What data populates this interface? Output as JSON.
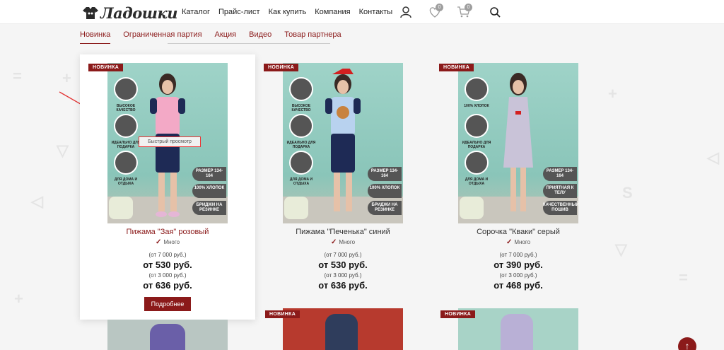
{
  "header": {
    "logo_text": "Ладошки",
    "nav": [
      "Каталог",
      "Прайс-лист",
      "Как купить",
      "Компания",
      "Контакты"
    ],
    "icons": [
      {
        "name": "user-icon"
      },
      {
        "name": "heart-icon",
        "badge": "0"
      },
      {
        "name": "cart-icon",
        "badge": "0"
      },
      {
        "name": "search-icon"
      }
    ]
  },
  "tabs": [
    "Новинка",
    "Ограниченная партия",
    "Акция",
    "Видео",
    "Товар партнера"
  ],
  "badge_new": "НОВИНКА",
  "quick_view": "Быстрый просмотр",
  "more_label": "Подробнее",
  "features": {
    "quality": "ВЫСОКОЕ КАЧЕСТВО",
    "gift": "ИДЕАЛЬНО ДЛЯ ПОДАРКА",
    "home": "ДЛЯ ДОМА И ОТДЫХА",
    "cotton": "100% ХЛОПОК"
  },
  "products": [
    {
      "title": "Пижама \"Зая\" розовый",
      "stock": "Много",
      "from1": "(от 7 000 руб.)",
      "price1": "от 530 руб.",
      "from2": "(от 3 000 руб.)",
      "price2": "от 636 руб.",
      "tags": [
        "РАЗМЕР 134-164",
        "100% ХЛОПОК",
        "БРИДЖИ НА РЕЗИНКЕ"
      ]
    },
    {
      "title": "Пижама \"Печенька\" синий",
      "stock": "Много",
      "from1": "(от 7 000 руб.)",
      "price1": "от 530 руб.",
      "from2": "(от 3 000 руб.)",
      "price2": "от 636 руб.",
      "tags": [
        "РАЗМЕР 134-164",
        "100% ХЛОПОК",
        "БРИДЖИ НА РЕЗИНКЕ"
      ]
    },
    {
      "title": "Сорочка \"Кваки\" серый",
      "stock": "Много",
      "from1": "(от 7 000 руб.)",
      "price1": "от 390 руб.",
      "from2": "(от 3 000 руб.)",
      "price2": "от 468 руб.",
      "tags": [
        "РАЗМЕР 134-164",
        "ПРИЯТНАЯ К ТЕЛУ",
        "КАЧЕСТВЕННЫЙ ПОШИВ"
      ]
    }
  ],
  "colors": {
    "accent": "#8b1a1a",
    "annotation": "#e33333"
  }
}
